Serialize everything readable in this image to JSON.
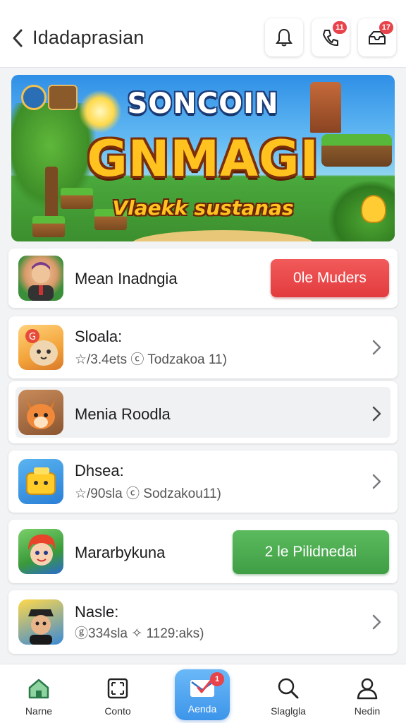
{
  "header": {
    "title": "Idadaprasian",
    "buttons": [
      {
        "icon": "bell-icon",
        "badge": ""
      },
      {
        "icon": "phone-icon",
        "badge": "11"
      },
      {
        "icon": "inbox-icon",
        "badge": "17"
      }
    ]
  },
  "banner": {
    "kicker": "SONCOIN",
    "title": "GNMAGI",
    "subtitle": "Vlaekk sustanas"
  },
  "list": [
    {
      "title": "Mean Inadngia",
      "subtitle": "",
      "action": "0le Muders",
      "action_color": "#e23b3e",
      "icon": "app-avatar-man-icon"
    },
    {
      "title": "Sloala:",
      "subtitle": "☆/3.4ets ⓒ Todzakoa 11)",
      "action": "",
      "icon": "app-cat-icon"
    },
    {
      "title": "Menia Roodla",
      "subtitle": "",
      "action": "",
      "icon": "app-fox-icon"
    },
    {
      "title": "Dhsea:",
      "subtitle": "☆/90sla ⓒ Sodzakou11)",
      "action": "",
      "icon": "app-block-icon"
    },
    {
      "title": "Mararbykuna",
      "subtitle": "",
      "action": "2 le Pilidnedai",
      "action_color": "#3f9e44",
      "icon": "app-girl-icon"
    },
    {
      "title": "Nasle:",
      "subtitle": "ⓖ334sla ✧ 1129:aks)",
      "action": "",
      "icon": "app-man-hat-icon"
    }
  ],
  "bottom_nav": [
    {
      "label": "Narne",
      "icon": "home-icon"
    },
    {
      "label": "Conto",
      "icon": "square-frame-icon"
    },
    {
      "label": "Aenda",
      "icon": "mail-check-icon",
      "badge": "1",
      "active": true
    },
    {
      "label": "Slaglgla",
      "icon": "search-icon"
    },
    {
      "label": "Nedin",
      "icon": "person-icon"
    }
  ],
  "colors": {
    "accent_blue": "#3d95ea",
    "badge_red": "#e8434a",
    "action_red": "#e23b3e",
    "action_green": "#3f9e44"
  }
}
